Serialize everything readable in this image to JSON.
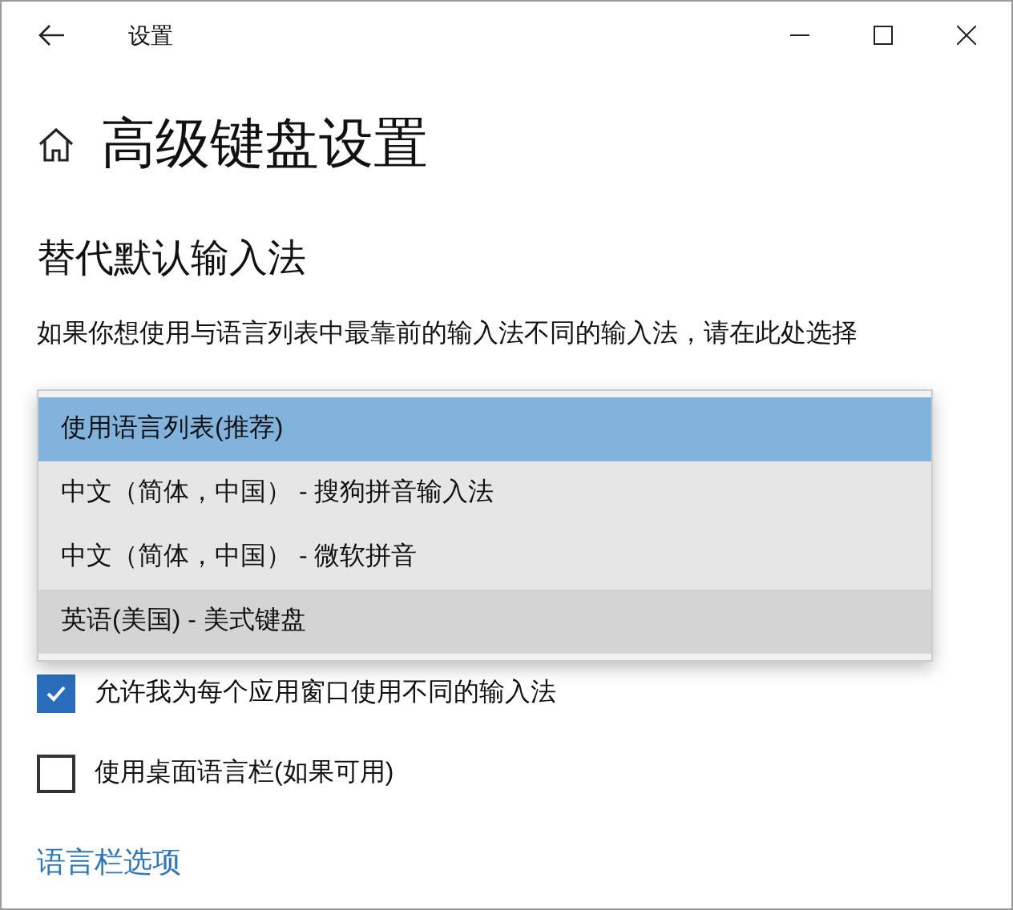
{
  "window": {
    "title": "设置"
  },
  "page": {
    "title": "高级键盘设置"
  },
  "section": {
    "heading": "替代默认输入法",
    "description": "如果你想使用与语言列表中最靠前的输入法不同的输入法，请在此处选择"
  },
  "dropdown_options": [
    {
      "label": "使用语言列表(推荐)",
      "selected": true,
      "hovered": false
    },
    {
      "label": "中文（简体，中国） - 搜狗拼音输入法",
      "selected": false,
      "hovered": false
    },
    {
      "label": "中文（简体，中国） - 微软拼音",
      "selected": false,
      "hovered": false
    },
    {
      "label": "英语(美国) - 美式键盘",
      "selected": false,
      "hovered": true
    }
  ],
  "checkboxes": [
    {
      "label": "允许我为每个应用窗口使用不同的输入法",
      "checked": true
    },
    {
      "label": "使用桌面语言栏(如果可用)",
      "checked": false
    }
  ],
  "link": "语言栏选项"
}
